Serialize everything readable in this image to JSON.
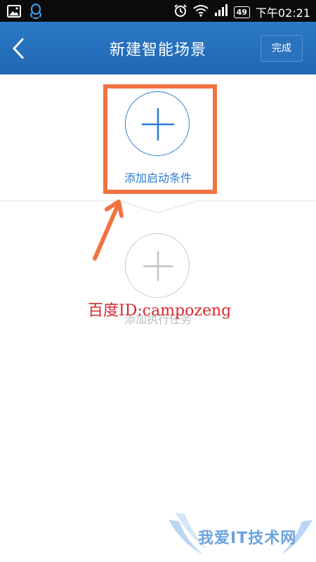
{
  "status_bar": {
    "icons_left": [
      "gallery-icon",
      "qq-icon"
    ],
    "icons_right": [
      "alarm-icon",
      "wifi-icon",
      "signal-icon"
    ],
    "battery": "49",
    "time": "下午02:21"
  },
  "app_bar": {
    "title": "新建智能场景",
    "done_label": "完成"
  },
  "condition": {
    "label": "添加启动条件"
  },
  "task": {
    "label": "添加执行任务"
  },
  "watermark": "百度ID:campozeng",
  "logo_text": "我爱IT技术网",
  "colors": {
    "accent": "#2a7bd0",
    "app_bar": "#2269b4",
    "highlight": "#f07240",
    "watermark": "#d9272e"
  }
}
